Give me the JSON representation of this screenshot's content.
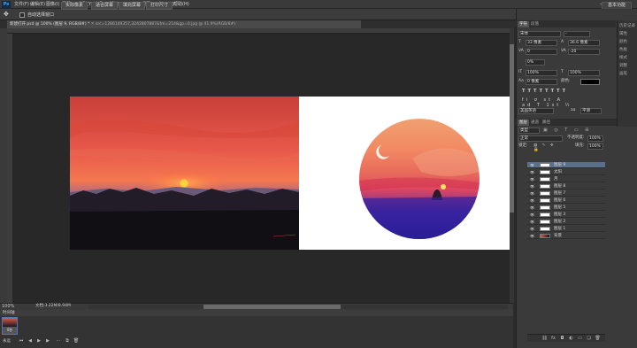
{
  "app": {
    "logo": "Ps",
    "accent": "#46a3f0"
  },
  "menu": [
    "文件(F)",
    "编辑(E)",
    "图像(I)",
    "图层(L)",
    "类型(Y)",
    "选择(S)",
    "滤镜(T)",
    "3D(D)",
    "视图(V)",
    "窗口(W)",
    "帮助(H)"
  ],
  "window_controls": [
    "—",
    "□",
    "✕"
  ],
  "options": {
    "auto_select_label": "自动选择窗口",
    "buttons": [
      "实际像素",
      "适合屏幕",
      "填充屏幕",
      "打印尺寸"
    ],
    "workspace": "基本功能"
  },
  "document": {
    "tab_title": "新建打开.psd @ 100% (图层 9, RGB/8#) *",
    "second_tab": "src=1286149357,3242807887&fm=214&gp=0.jpg @ 41.9%(RGB/8#)",
    "zoom": "100%",
    "doc_size": "文档:3.22M/8.94M"
  },
  "timeline": {
    "title": "时间轴",
    "frame_label": "1",
    "frame_time": "0秒",
    "loop": "永远"
  },
  "character": {
    "tabs": [
      "字符",
      "段落"
    ],
    "font_family": "宋体",
    "font_style": "-",
    "font_size": "33 像素",
    "leading": "36.6 像素",
    "kerning": "0",
    "tracking": "-20",
    "scale_v": "100%",
    "scale_h": "100%",
    "baseline": "0 像素",
    "color_label": "颜色:",
    "percent": "0%",
    "lang": "美国英语",
    "aa": "平滑"
  },
  "side_strip": [
    "历史记录",
    "属性",
    "颜色",
    "色板",
    "样式",
    "调整",
    "画笔"
  ],
  "layers": {
    "tabs": [
      "图层",
      "通道",
      "路径"
    ],
    "kind": "类型",
    "blend": "正常",
    "opacity_label": "不透明度:",
    "opacity": "100%",
    "lock_label": "锁定:",
    "fill_label": "填充:",
    "fill": "100%",
    "items": [
      {
        "name": "图层 9",
        "selected": true
      },
      {
        "name": "太阳",
        "selected": false
      },
      {
        "name": "月",
        "selected": false
      },
      {
        "name": "图层 8",
        "selected": false
      },
      {
        "name": "图层 7",
        "selected": false
      },
      {
        "name": "图层 6",
        "selected": false
      },
      {
        "name": "图层 5",
        "selected": false
      },
      {
        "name": "图层 3",
        "selected": false
      },
      {
        "name": "图层 2",
        "selected": false
      },
      {
        "name": "图层 1",
        "selected": false
      },
      {
        "name": "背景",
        "selected": false
      }
    ],
    "footer_icons": [
      "link-icon",
      "fx-icon",
      "mask-icon",
      "adjust-icon",
      "folder-icon",
      "new-layer-icon",
      "trash-icon"
    ]
  },
  "colors": {
    "sky_top": "#d84a3a",
    "sky_mid": "#f06a48",
    "sun": "#ffd040",
    "mountain": "#1a1620",
    "circle_bottom": "#2a2090"
  }
}
